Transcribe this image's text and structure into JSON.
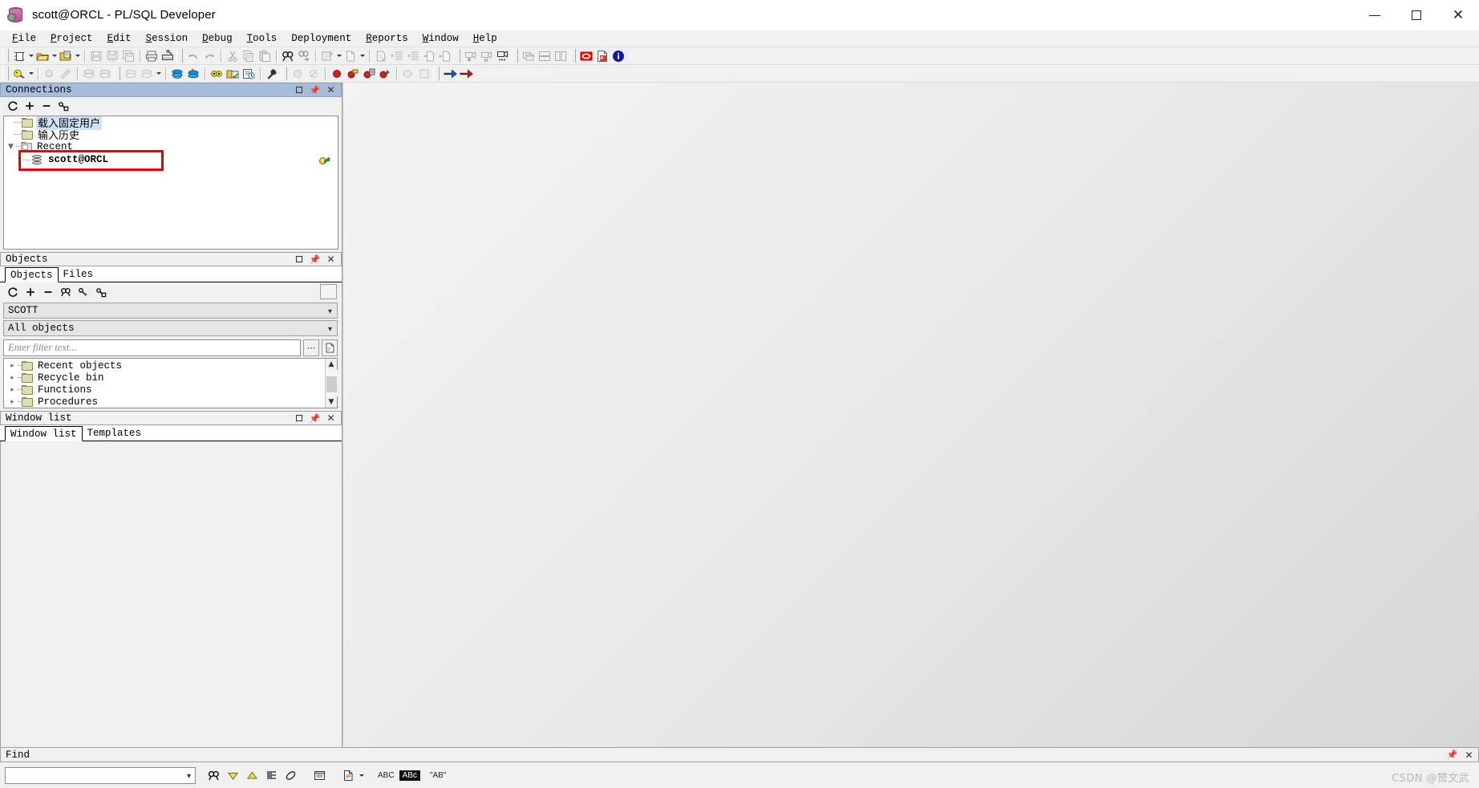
{
  "window": {
    "title": "scott@ORCL - PL/SQL Developer",
    "app_icon": "database-gear-icon",
    "minimize": "minimize-icon",
    "maximize": "maximize-icon",
    "close": "close-icon"
  },
  "menubar": {
    "items": [
      {
        "label": "File",
        "accel": "F"
      },
      {
        "label": "Project",
        "accel": "P"
      },
      {
        "label": "Edit",
        "accel": "E"
      },
      {
        "label": "Session",
        "accel": "S"
      },
      {
        "label": "Debug",
        "accel": "D"
      },
      {
        "label": "Tools",
        "accel": "T"
      },
      {
        "label": "Deployment",
        "accel": ""
      },
      {
        "label": "Reports",
        "accel": "R"
      },
      {
        "label": "Window",
        "accel": "W"
      },
      {
        "label": "Help",
        "accel": "H"
      }
    ]
  },
  "toolbar_row1": {
    "groups": [
      [
        "new-file-icon",
        "open-file-icon",
        "open-recent-icon"
      ],
      [
        "save-icon",
        "save-as-icon",
        "save-all-icon"
      ],
      [
        "print-icon",
        "print-setup-icon"
      ],
      [
        "undo-icon",
        "redo-icon"
      ],
      [
        "cut-icon",
        "copy-icon",
        "paste-icon"
      ],
      [
        "find-icon",
        "find-next-icon"
      ],
      [
        "replace-icon",
        "new-document-icon"
      ],
      [
        "comment-icon",
        "indent-icon",
        "unindent-icon",
        "insert-file-icon",
        "extract-file-icon"
      ],
      [
        "record-macro-icon",
        "pause-macro-icon",
        "macro-list-icon"
      ],
      [
        "cascade-windows-icon",
        "tile-horizontal-icon",
        "tile-vertical-icon"
      ],
      [
        "oracle-logo-icon",
        "pdf-export-icon",
        "about-info-icon"
      ]
    ]
  },
  "toolbar_row2": {
    "groups": [
      [
        "explain-plan-icon"
      ],
      [
        "session-info-icon",
        "optimizer-icon"
      ],
      [
        "commit-icon",
        "rollback-icon"
      ],
      [
        "db-object-icon",
        "db-object-list-icon"
      ],
      [
        "test-window-icon",
        "sql-window-icon"
      ],
      [
        "browser-icon",
        "notes-icon",
        "history-icon"
      ],
      [
        "tools-wrench-icon"
      ],
      [
        "breakpoint-none-icon",
        "breakpoint-off-icon"
      ],
      [
        "break-icon",
        "step-over-icon",
        "step-into-icon",
        "step-out-icon"
      ],
      [
        "run-icon",
        "stop-icon"
      ],
      [
        "prev-arrow-icon",
        "next-arrow-icon"
      ]
    ]
  },
  "connections_panel": {
    "title": "Connections",
    "header_buttons": [
      "maximize-icon",
      "pin-icon",
      "close-icon"
    ],
    "toolbar": [
      "refresh-icon",
      "add-icon",
      "remove-icon",
      "configure-icon"
    ],
    "tree": [
      {
        "label": "载入固定用户",
        "icon": "folder-icon",
        "depth": 1,
        "selected": true,
        "expandable": false
      },
      {
        "label": "输入历史",
        "icon": "folder-icon",
        "depth": 1,
        "selected": false,
        "expandable": false
      },
      {
        "label": "Recent",
        "icon": "folder-grey-icon",
        "depth": 0,
        "selected": false,
        "expandable": true,
        "expanded": true
      },
      {
        "label": "scott@ORCL",
        "icon": "database-icon",
        "depth": 2,
        "selected": false,
        "expandable": false,
        "highlighted": true
      }
    ],
    "highlight_color": "#ef0000",
    "status_icon": "key-icon"
  },
  "objects_panel": {
    "title": "Objects",
    "header_buttons": [
      "maximize-icon",
      "pin-icon",
      "close-icon"
    ],
    "tabs": [
      {
        "label": "Objects",
        "active": true
      },
      {
        "label": "Files",
        "active": false
      }
    ],
    "toolbar": [
      "refresh-icon",
      "add-icon",
      "remove-icon",
      "find-icon",
      "filter-icon",
      "configure-icon"
    ],
    "schema_select": {
      "value": "SCOTT"
    },
    "type_select": {
      "value": "All objects"
    },
    "filter_input": {
      "value": "",
      "placeholder": "Enter filter text..."
    },
    "filter_buttons": [
      "ellipsis-button",
      "document-filter-icon"
    ],
    "tree": [
      {
        "label": "Recent objects",
        "icon": "folder-icon"
      },
      {
        "label": "Recycle bin",
        "icon": "folder-icon"
      },
      {
        "label": "Functions",
        "icon": "folder-icon"
      },
      {
        "label": "Procedures",
        "icon": "folder-icon"
      }
    ]
  },
  "window_list_panel": {
    "title": "Window list",
    "header_buttons": [
      "maximize-icon",
      "pin-icon",
      "close-icon"
    ],
    "tabs": [
      {
        "label": "Window list",
        "active": true
      },
      {
        "label": "Templates",
        "active": false
      }
    ]
  },
  "find_bar": {
    "title": "Find",
    "header_buttons": [
      "pin-icon",
      "close-icon"
    ],
    "search_input": {
      "value": "",
      "placeholder": ""
    },
    "buttons": [
      {
        "name": "find-icon",
        "label": ""
      },
      {
        "name": "find-down-icon",
        "label": ""
      },
      {
        "name": "find-up-icon",
        "label": ""
      },
      {
        "name": "find-all-icon",
        "label": ""
      },
      {
        "name": "clear-highlight-icon",
        "label": ""
      },
      {
        "name": "find-in-window-icon",
        "label": ""
      },
      {
        "name": "find-in-files-icon",
        "label": ""
      }
    ],
    "toggles": [
      {
        "name": "match-case-toggle",
        "label": "ABC"
      },
      {
        "name": "whole-word-toggle",
        "label": "ABc"
      },
      {
        "name": "regex-toggle",
        "label": "\"AB\""
      }
    ]
  },
  "watermark": {
    "text": "CSDN @赞文武"
  }
}
